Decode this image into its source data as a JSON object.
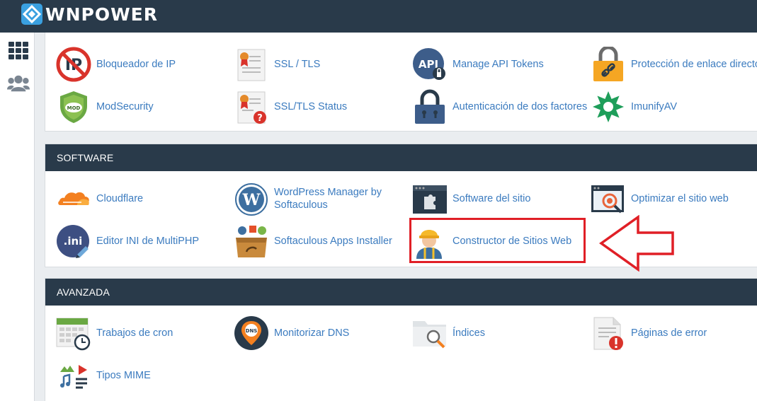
{
  "brand": {
    "name": "WNPOWER"
  },
  "sidebar": {
    "items": [
      {
        "icon": "grid-icon"
      },
      {
        "icon": "users-icon"
      }
    ]
  },
  "security": {
    "items": [
      {
        "label": "Bloqueador de IP",
        "icon": "ip-blocker-icon"
      },
      {
        "label": "SSL / TLS",
        "icon": "ssl-certificate-icon"
      },
      {
        "label": "Manage API Tokens",
        "icon": "api-key-icon"
      },
      {
        "label": "Protección de enlace directo",
        "icon": "hotlink-lock-icon"
      },
      {
        "label": "ModSecurity",
        "icon": "modsecurity-shield-icon"
      },
      {
        "label": "SSL/TLS Status",
        "icon": "ssl-status-icon"
      },
      {
        "label": "Autenticación de dos factores",
        "icon": "padlock-icon"
      },
      {
        "label": "ImunifyAV",
        "icon": "imunify-icon"
      }
    ]
  },
  "software": {
    "title": "SOFTWARE",
    "items": [
      {
        "label": "Cloudflare",
        "icon": "cloudflare-icon"
      },
      {
        "label": "WordPress Manager by Softaculous",
        "icon": "wordpress-icon"
      },
      {
        "label": "Software del sitio",
        "icon": "puzzle-window-icon"
      },
      {
        "label": "Optimizar el sitio web",
        "icon": "optimize-gear-icon"
      },
      {
        "label": "Editor INI de MultiPHP",
        "icon": "ini-editor-icon"
      },
      {
        "label": "Softaculous Apps Installer",
        "icon": "softaculous-box-icon"
      },
      {
        "label": "Constructor de Sitios Web",
        "icon": "builder-worker-icon"
      }
    ]
  },
  "advanced": {
    "title": "AVANZADA",
    "items": [
      {
        "label": "Trabajos de cron",
        "icon": "calendar-clock-icon"
      },
      {
        "label": "Monitorizar DNS",
        "icon": "dns-pin-icon"
      },
      {
        "label": "Índices",
        "icon": "folder-search-icon"
      },
      {
        "label": "Páginas de error",
        "icon": "error-page-icon"
      },
      {
        "label": "Tipos MIME",
        "icon": "mime-types-icon"
      }
    ]
  },
  "colors": {
    "header": "#293a4a",
    "link": "#3b7bbf",
    "highlight": "#e01f26"
  }
}
